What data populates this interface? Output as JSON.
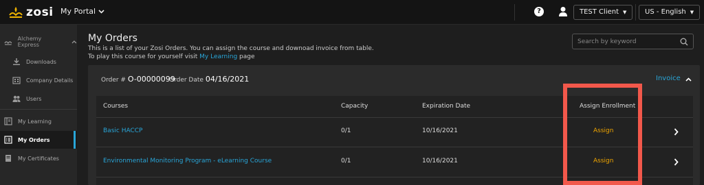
{
  "topbar": {
    "logo_text": "zosi",
    "portal_label": "My Portal",
    "help_glyph": "?",
    "account_label": "TEST Client",
    "language_label": "US - English"
  },
  "sidebar": {
    "group_label": "Alchemy Express",
    "items": [
      {
        "label": "Downloads",
        "icon": "download-icon"
      },
      {
        "label": "Company Details",
        "icon": "building-icon"
      },
      {
        "label": "Users",
        "icon": "users-icon"
      },
      {
        "label": "My Learning",
        "icon": "book-icon"
      },
      {
        "label": "My Orders",
        "icon": "list-icon"
      },
      {
        "label": "My Certificates",
        "icon": "certificate-icon"
      }
    ],
    "active_item": "My Orders",
    "accent_color": "#29a6d9"
  },
  "main": {
    "title": "My Orders",
    "subtitle_line1": "This is a list of your Zosi Orders. You can assign the course and downoad invoice from table.",
    "subtitle_line2_prefix": "To play this course for yourself visit",
    "subtitle_link": "My Learning",
    "subtitle_line2_suffix": "page",
    "search_placeholder": "Search by keyword"
  },
  "order": {
    "number_label": "Order #",
    "number": "O-00000099",
    "date_label": "Order Date",
    "date": "04/16/2021",
    "invoice_label": "Invoice",
    "headers": [
      "Courses",
      "Capacity",
      "Expiration Date",
      "Assign Enrollment"
    ],
    "rows": [
      {
        "course": "Basic HACCP",
        "capacity": "0/1",
        "expiration": "10/16/2021",
        "action": "Assign"
      },
      {
        "course": "Environmental Monitoring Program - eLearning Course",
        "capacity": "0/1",
        "expiration": "10/16/2021",
        "action": "Assign"
      }
    ]
  },
  "colors": {
    "accent": "#29a6d9",
    "assign": "#f0a500",
    "highlight_box": "#f2584b"
  }
}
